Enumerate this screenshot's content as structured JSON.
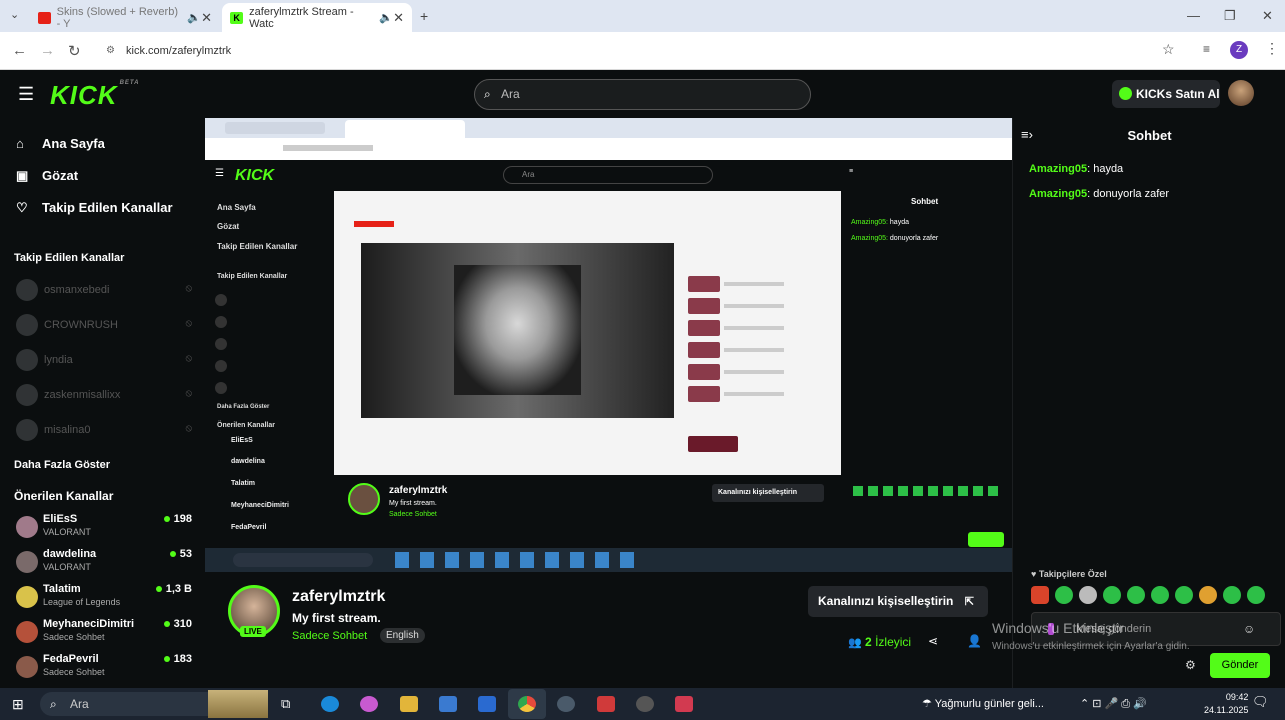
{
  "browser": {
    "tabs": [
      {
        "title": "Skins (Slowed + Reverb) - Y",
        "favicon": "youtube-icon",
        "active": false
      },
      {
        "title": "zaferylmztrk Stream - Watc",
        "favicon": "kick-icon",
        "active": true
      }
    ],
    "url": "kick.com/zaferylmztrk",
    "profile_initial": "Z"
  },
  "kick": {
    "logo": "KICK",
    "logo_badge": "BETA",
    "search_placeholder": "Ara",
    "kicks_button": "KICKs Satın Al"
  },
  "sidebar": {
    "nav": [
      {
        "label": "Ana Sayfa",
        "icon": "home-icon"
      },
      {
        "label": "Gözat",
        "icon": "browse-icon"
      },
      {
        "label": "Takip Edilen Kanallar",
        "icon": "heart-icon"
      }
    ],
    "followed_heading": "Takip Edilen Kanallar",
    "followed": [
      {
        "name": "osmanxebedi"
      },
      {
        "name": "CROWNRUSH"
      },
      {
        "name": "lyndia"
      },
      {
        "name": "zaskenmisallixx"
      },
      {
        "name": "misalina0"
      }
    ],
    "show_more": "Daha Fazla Göster",
    "recommended_heading": "Önerilen Kanallar",
    "recommended": [
      {
        "name": "EliEsS",
        "category": "VALORANT",
        "viewers": "198"
      },
      {
        "name": "dawdelina",
        "category": "VALORANT",
        "viewers": "53"
      },
      {
        "name": "Talatim",
        "category": "League of Legends",
        "viewers": "1,3 B"
      },
      {
        "name": "MeyhaneciDimitri",
        "category": "Sadece Sohbet",
        "viewers": "310"
      },
      {
        "name": "FedaPevril",
        "category": "Sadece Sohbet",
        "viewers": "183"
      }
    ]
  },
  "stream": {
    "streamer": "zaferylmztrk",
    "title": "My first stream.",
    "category": "Sadece Sohbet",
    "language": "English",
    "live_badge": "LIVE",
    "customize_button": "Kanalınızı kişiselleştirin",
    "viewer_count": "2",
    "viewer_label": "İzleyici"
  },
  "chat": {
    "title": "Sohbet",
    "messages": [
      {
        "user": "Amazing05",
        "text": "hayda"
      },
      {
        "user": "Amazing05",
        "text": "donuyorla zafer"
      }
    ],
    "emote_label": "Takipçilere Özel",
    "input_placeholder": "Mesaj gönderin",
    "send_button": "Gönder"
  },
  "windows_watermark": {
    "title": "Windows'u Etkinleştir",
    "subtitle": "Windows'u etkinleştirmek için Ayarlar'a gidin."
  },
  "taskbar": {
    "search_placeholder": "Ara",
    "weather": "Yağmurlu günler geli...",
    "time": "09:42",
    "date": "24.11.2025"
  },
  "colors": {
    "kick_green": "#53fc18",
    "background": "#0b0e0f",
    "panel": "#24272b"
  }
}
